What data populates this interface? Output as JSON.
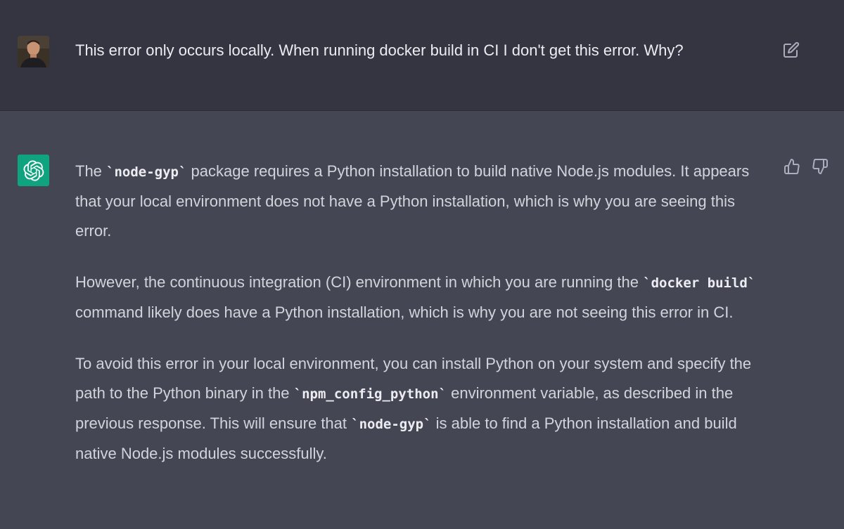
{
  "user_message": {
    "text": "This error only occurs locally. When running docker build in CI I don't get this error. Why?"
  },
  "assistant_message": {
    "p1": {
      "a": "The ",
      "code1": "`node-gyp`",
      "b": " package requires a Python installation to build native Node.js modules. It appears that your local environment does not have a Python installation, which is why you are seeing this error."
    },
    "p2": {
      "a": "However, the continuous integration (CI) environment in which you are running the ",
      "code1": "`docker build`",
      "b": " command likely does have a Python installation, which is why you are not seeing this error in CI."
    },
    "p3": {
      "a": "To avoid this error in your local environment, you can install Python on your system and specify the path to the Python binary in the ",
      "code1": "`npm_config_python`",
      "b": " environment variable, as described in the previous response. This will ensure that ",
      "code2": "`node-gyp`",
      "c": " is able to find a Python installation and build native Node.js modules successfully."
    }
  },
  "icons": {
    "user_avatar": "user-avatar",
    "edit": "edit-icon",
    "assistant_logo": "openai-logo-icon",
    "thumbs_up": "thumbs-up-icon",
    "thumbs_down": "thumbs-down-icon"
  },
  "colors": {
    "user_bg": "#343541",
    "assistant_bg": "#444654",
    "logo_bg": "#10a37f",
    "text": "#d1d5db"
  }
}
